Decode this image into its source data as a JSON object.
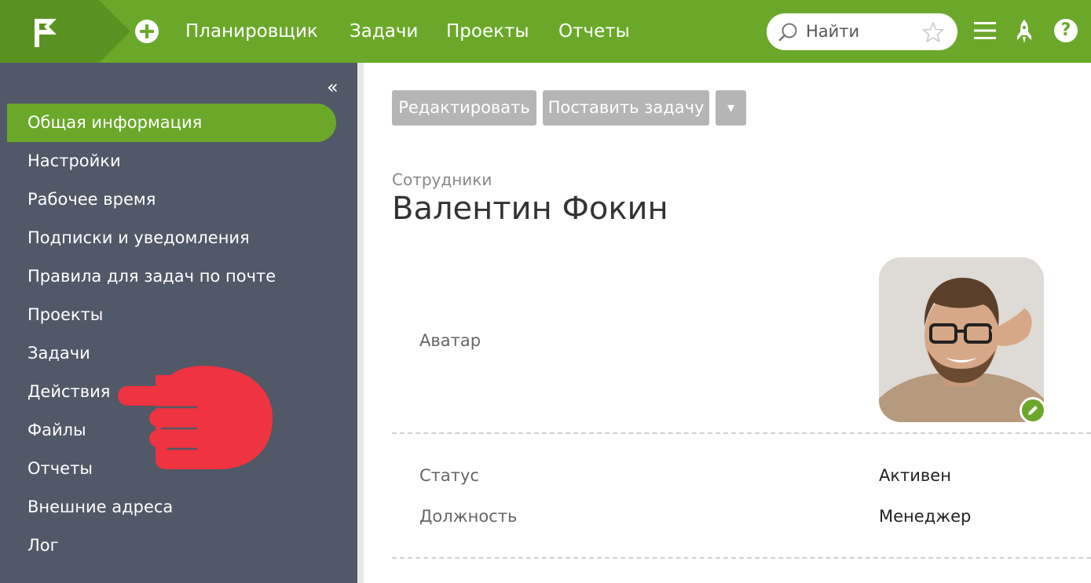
{
  "topbar": {
    "nav": [
      "Планировщик",
      "Задачи",
      "Проекты",
      "Отчеты"
    ],
    "search_placeholder": "Найти",
    "help_label": "?",
    "brand_color": "#6ba82a"
  },
  "sidebar": {
    "collapse_label": "«",
    "items": [
      {
        "label": "Общая информация",
        "active": true
      },
      {
        "label": "Настройки"
      },
      {
        "label": "Рабочее время"
      },
      {
        "label": "Подписки и уведомления"
      },
      {
        "label": "Правила для задач по почте"
      },
      {
        "label": "Проекты"
      },
      {
        "label": "Задачи"
      },
      {
        "label": "Действия"
      },
      {
        "label": "Файлы"
      },
      {
        "label": "Отчеты"
      },
      {
        "label": "Внешние адреса"
      },
      {
        "label": "Лог"
      }
    ],
    "background_color": "#515867"
  },
  "toolbar": {
    "edit_label": "Редактировать",
    "assign_label": "Поставить задачу",
    "more_label": "▾"
  },
  "page": {
    "breadcrumb": "Сотрудники",
    "title": "Валентин Фокин"
  },
  "profile": {
    "avatar_label": "Аватар",
    "status_label": "Статус",
    "status_value": "Активен",
    "position_label": "Должность",
    "position_value": "Менеджер"
  }
}
